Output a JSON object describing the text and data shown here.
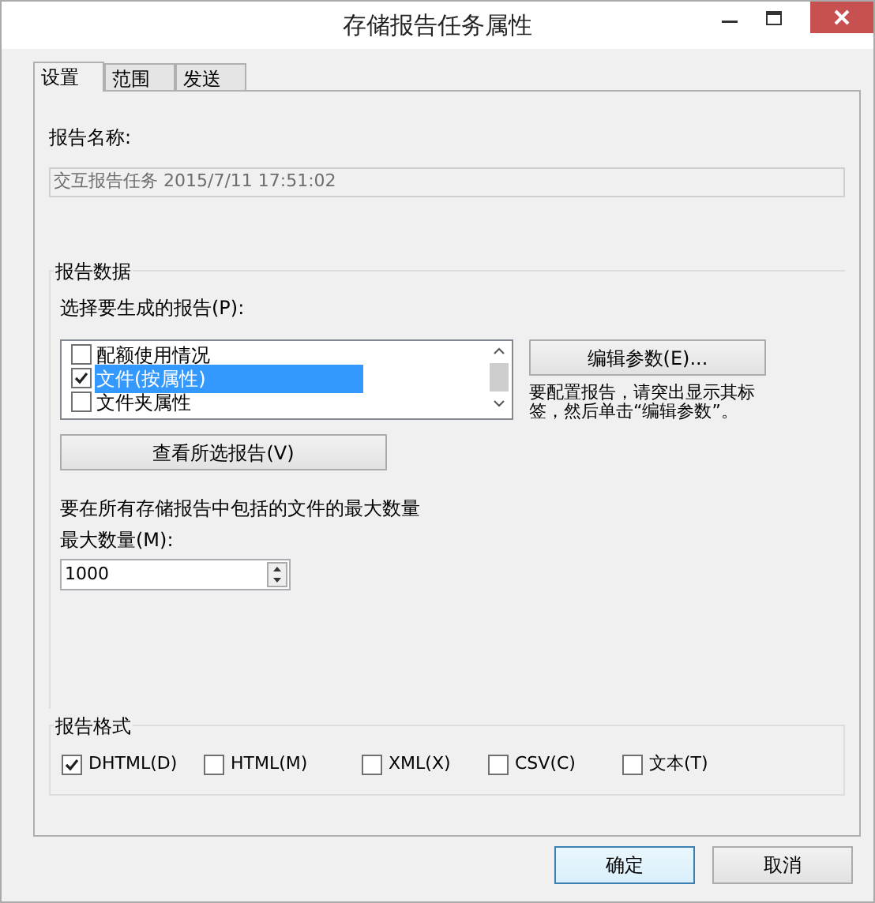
{
  "window": {
    "title": "存储报告任务属性"
  },
  "tabs": [
    {
      "label": "设置",
      "selected": true
    },
    {
      "label": "范围",
      "selected": false
    },
    {
      "label": "发送",
      "selected": false
    }
  ],
  "report_name": {
    "label": "报告名称:",
    "value": "交互报告任务 2015/7/11 17:51:02"
  },
  "report_data": {
    "title": "报告数据",
    "list_label": "选择要生成的报告(P):",
    "reports": [
      {
        "label": "配额使用情况",
        "checked": false,
        "selected": false
      },
      {
        "label": "文件(按属性)",
        "checked": true,
        "selected": true
      },
      {
        "label": "文件夹属性",
        "checked": false,
        "selected": false
      }
    ],
    "edit_button": "编辑参数(E)...",
    "hint": "要配置报告，请突出显示其标签，然后单击“编辑参数”。",
    "view_button": "查看所选报告(V)",
    "max_text": "要在所有存储报告中包括的文件的最大数量",
    "max_label": "最大数量(M):",
    "max_value": "1000"
  },
  "report_format": {
    "title": "报告格式",
    "formats": [
      {
        "label": "DHTML(D)",
        "checked": true
      },
      {
        "label": "HTML(M)",
        "checked": false
      },
      {
        "label": "XML(X)",
        "checked": false
      },
      {
        "label": "CSV(C)",
        "checked": false
      },
      {
        "label": "文本(T)",
        "checked": false
      }
    ]
  },
  "buttons": [
    {
      "label": "确定",
      "default": true
    },
    {
      "label": "取消",
      "default": false
    }
  ]
}
